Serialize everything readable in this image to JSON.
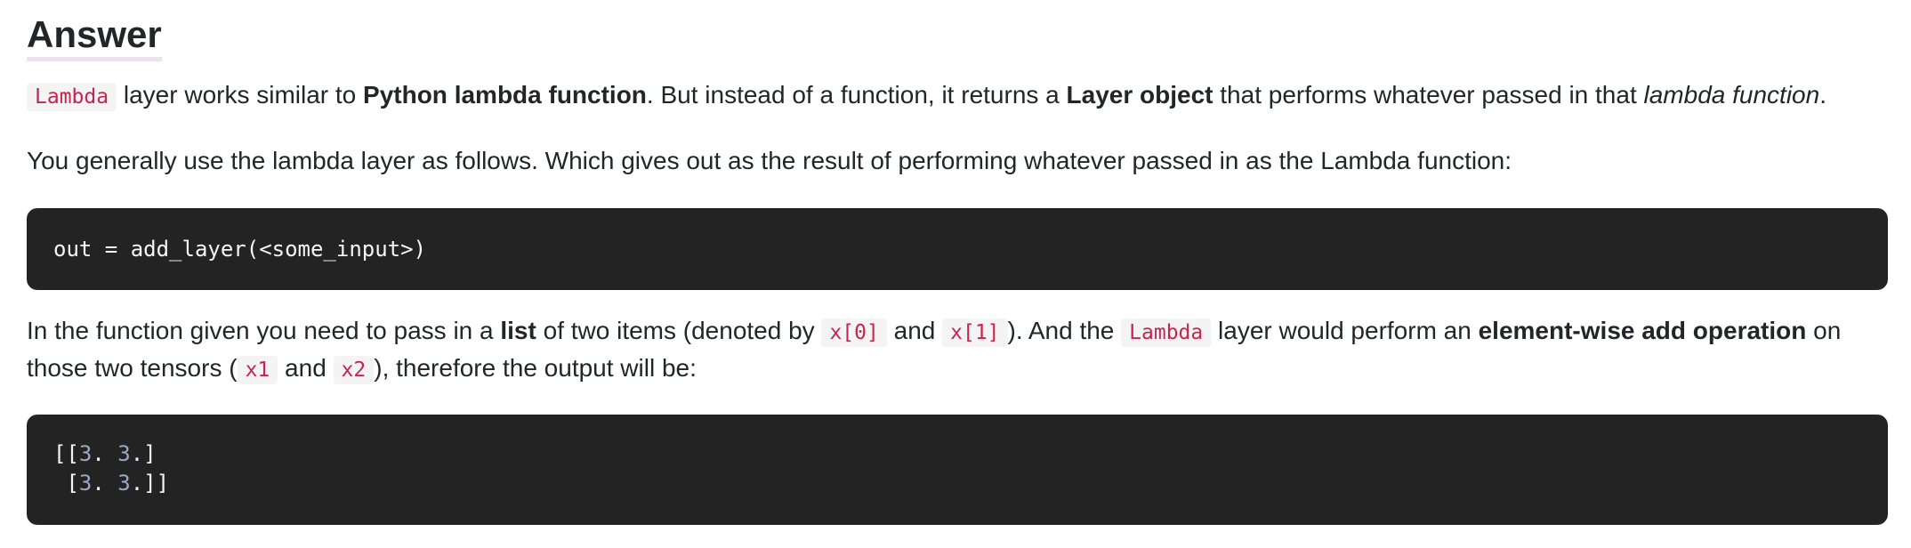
{
  "heading": "Answer",
  "para1": {
    "code_lambda": "Lambda",
    "t1": " layer works similar to ",
    "b1": "Python lambda function",
    "t2": ". But instead of a function, it returns a ",
    "b2": "Layer object",
    "t3": " that performs whatever passed in that ",
    "i1": "lambda function",
    "t4": "."
  },
  "para2": "You generally use the lambda layer as follows. Which gives out as the result of performing whatever passed in as the Lambda function:",
  "code_block_1": "out = add_layer(<some_input>)",
  "para3": {
    "t1": "In the function given you need to pass in a ",
    "b1": "list",
    "t2": " of two items (denoted by ",
    "c1": "x[0]",
    "t3": " and ",
    "c2": "x[1]",
    "t4": "). And the ",
    "c3": "Lambda",
    "t5": " layer would perform an ",
    "b2": "element-wise add operation",
    "t6": " on",
    "t7": "those two tensors (",
    "c4": "x1",
    "t8": " and ",
    "c5": "x2",
    "t9": "), therefore the output will be:"
  },
  "code_block_2": {
    "line1": {
      "open": "[[",
      "n1": "3",
      "s1": ". ",
      "n2": "3",
      "close": ".]"
    },
    "line2": {
      "open": " [",
      "n1": "3",
      "s1": ". ",
      "n2": "3",
      "close": ".]]"
    }
  }
}
